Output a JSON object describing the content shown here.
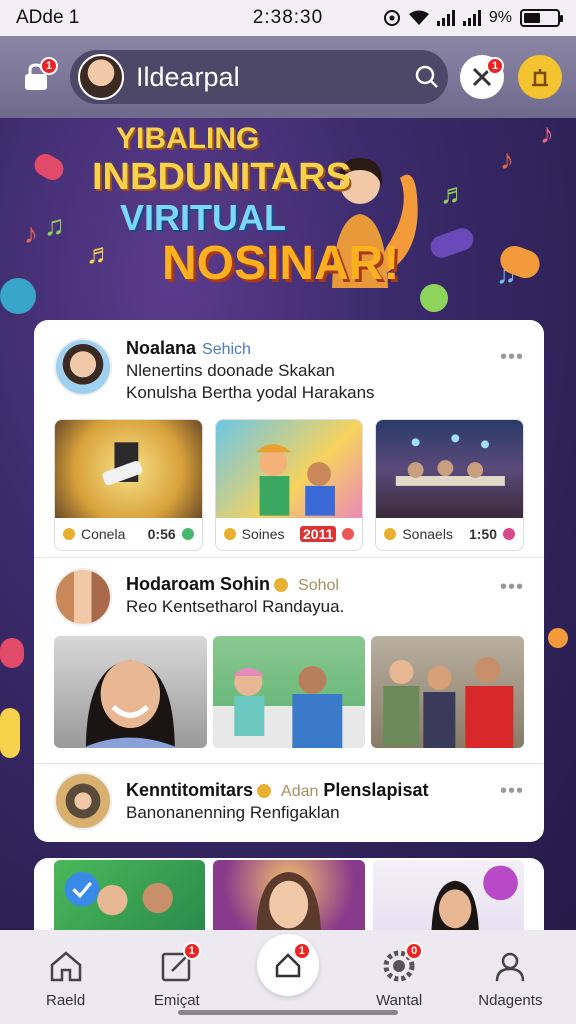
{
  "status_bar": {
    "carrier": "ADde 1",
    "time": "2:38:30",
    "battery_text": "9%",
    "battery_level": 0.55
  },
  "app_bar": {
    "lock_badge": "1",
    "search_text": "Ildearpal",
    "notif_badge": "1"
  },
  "hero": {
    "line1": "YIBALING",
    "line2": "INBDUNITARS",
    "line3": "VIRITUAL",
    "line4": "NOSINAR!"
  },
  "posts": [
    {
      "name": "Noalana",
      "tag": "Sehich",
      "line1": "Nlenertins doonade Skakan",
      "line2": "Konulsha Bertha yodal Harakans",
      "more": "•••",
      "tiles": [
        {
          "label": "Conela",
          "value": "0:56",
          "chip_color": "#47b86c",
          "bg": "#f4d35e"
        },
        {
          "label": "Soines",
          "value": "2011",
          "chip_color": "#e55",
          "bg": "#6bc7e6"
        },
        {
          "label": "Sonaels",
          "value": "1:50",
          "chip_color": "#d94a8a",
          "bg": "#4a3b5a"
        }
      ]
    },
    {
      "name": "Hodaroam Sohin",
      "tag": "Sohol",
      "line1": "Reo Kentsetharol Randayua.",
      "more": "•••"
    },
    {
      "name": "Kenntitomitars",
      "tag": "Adan",
      "name_extra": "Plenslapisat",
      "line1": "Banonanenning Renfigaklan",
      "more": "•••"
    }
  ],
  "bottom_nav": {
    "items": [
      {
        "label": "Raeld",
        "icon": "home-icon"
      },
      {
        "label": "Emiçat",
        "icon": "edit-icon",
        "badge": "1"
      },
      {
        "label": "",
        "icon": "compose-icon",
        "badge": "1"
      },
      {
        "label": "Wantal",
        "icon": "settings-icon",
        "badge": "0"
      },
      {
        "label": "Ndagents",
        "icon": "profile-icon"
      }
    ]
  }
}
